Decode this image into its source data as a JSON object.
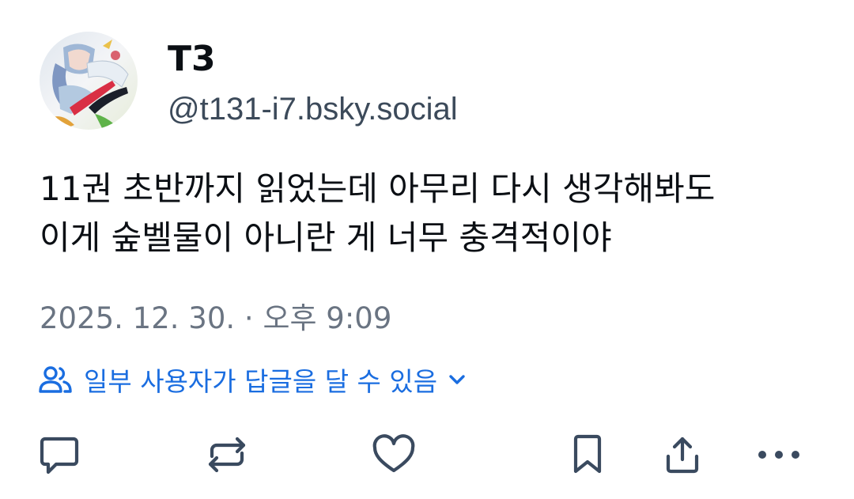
{
  "author": {
    "display_name": "T3",
    "handle": "@t131-i7.bsky.social"
  },
  "post": {
    "text_lines": [
      "11권 초반까지 읽었는데 아무리 다시 생각해봐도",
      "이게 숲벨물이 아니란 게 너무 충격적이야"
    ],
    "date": "2025. 12. 30.",
    "separator": " · ",
    "time": "오후 9:09"
  },
  "reply_settings": {
    "label": "일부 사용자가 답글을 달 수 있음",
    "icon": "people-icon",
    "chevron": "chevron-down-icon"
  },
  "actions": [
    {
      "name": "reply",
      "icon": "speech-bubble-icon"
    },
    {
      "name": "repost",
      "icon": "repost-arrows-icon"
    },
    {
      "name": "like",
      "icon": "heart-icon"
    },
    {
      "name": "bookmark",
      "icon": "bookmark-icon"
    },
    {
      "name": "share",
      "icon": "share-upload-icon"
    },
    {
      "name": "more",
      "icon": "more-dots-icon"
    }
  ],
  "colors": {
    "text_primary": "#0b0f14",
    "text_secondary": "#6a7482",
    "accent": "#1a6de0",
    "icon": "#3a4a5f"
  }
}
